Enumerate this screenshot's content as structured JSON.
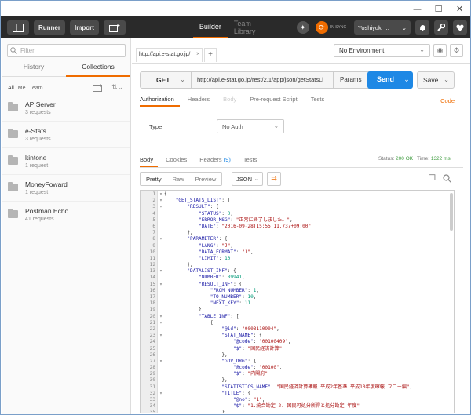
{
  "window": {
    "minimize": "—",
    "maximize": "☐",
    "close": "✕"
  },
  "toolbar": {
    "runner": "Runner",
    "import": "Import",
    "builder": "Builder",
    "team_library": "Team Library",
    "sync": "IN SYNC",
    "user": "Yoshiyuki ..."
  },
  "sidebar": {
    "filter_placeholder": "Filter",
    "tabs": [
      "History",
      "Collections"
    ],
    "sub": [
      "All",
      "Me",
      "Team"
    ],
    "collections": [
      {
        "name": "APIServer",
        "requests": "3 requests"
      },
      {
        "name": "e-Stats",
        "requests": "3 requests"
      },
      {
        "name": "kintone",
        "requests": "1 request"
      },
      {
        "name": "MoneyFoward",
        "requests": "1 request"
      },
      {
        "name": "Postman Echo",
        "requests": "41 requests"
      }
    ]
  },
  "request": {
    "tab_label": "http://api.e-stat.go.jp/",
    "tab_close": "×",
    "add_tab": "+",
    "environment": "No Environment",
    "method": "GET",
    "url": "http://api.e-stat.go.jp/rest/2.1/app/json/getStatsList?appId=&lang=J&searchWord=",
    "params": "Params",
    "send": "Send",
    "save": "Save",
    "tabs": [
      "Authorization",
      "Headers",
      "Body",
      "Pre-request Script",
      "Tests"
    ],
    "code": "Code",
    "type_label": "Type",
    "type_value": "No Auth"
  },
  "response": {
    "tabs": [
      "Body",
      "Cookies",
      "Headers",
      "Tests"
    ],
    "headers_count": "(9)",
    "status_label": "Status:",
    "status_value": "200 OK",
    "time_label": "Time:",
    "time_value": "1322 ms",
    "views": [
      "Pretty",
      "Raw",
      "Preview"
    ],
    "format": "JSON",
    "lines": [
      {
        "fold": "▾",
        "text": "{"
      },
      {
        "fold": "▾",
        "text": "    \"GET_STATS_LIST\": {"
      },
      {
        "fold": "▾",
        "text": "        \"RESULT\": {"
      },
      {
        "fold": "",
        "text": "            \"STATUS\": 0,"
      },
      {
        "fold": "",
        "text": "            \"ERROR_MSG\": \"正常に終了しました。\","
      },
      {
        "fold": "",
        "text": "            \"DATE\": \"2016-09-28T15:55:11.737+09:00\""
      },
      {
        "fold": "",
        "text": "        },"
      },
      {
        "fold": "▾",
        "text": "        \"PARAMETER\": {"
      },
      {
        "fold": "",
        "text": "            \"LANG\": \"J\","
      },
      {
        "fold": "",
        "text": "            \"DATA_FORMAT\": \"J\","
      },
      {
        "fold": "",
        "text": "            \"LIMIT\": 10"
      },
      {
        "fold": "",
        "text": "        },"
      },
      {
        "fold": "▾",
        "text": "        \"DATALIST_INF\": {"
      },
      {
        "fold": "",
        "text": "            \"NUMBER\": 89941,"
      },
      {
        "fold": "▾",
        "text": "            \"RESULT_INF\": {"
      },
      {
        "fold": "",
        "text": "                \"FROM_NUMBER\": 1,"
      },
      {
        "fold": "",
        "text": "                \"TO_NUMBER\": 10,"
      },
      {
        "fold": "",
        "text": "                \"NEXT_KEY\": 11"
      },
      {
        "fold": "",
        "text": "            },"
      },
      {
        "fold": "▾",
        "text": "            \"TABLE_INF\": ["
      },
      {
        "fold": "▾",
        "text": "                {"
      },
      {
        "fold": "",
        "text": "                    \"@id\": \"0003110904\","
      },
      {
        "fold": "▾",
        "text": "                    \"STAT_NAME\": {"
      },
      {
        "fold": "",
        "text": "                        \"@code\": \"00100409\","
      },
      {
        "fold": "",
        "text": "                        \"$\": \"国民経済計算\""
      },
      {
        "fold": "",
        "text": "                    },"
      },
      {
        "fold": "▾",
        "text": "                    \"GOV_ORG\": {"
      },
      {
        "fold": "",
        "text": "                        \"@code\": \"00100\","
      },
      {
        "fold": "",
        "text": "                        \"$\": \"内閣府\""
      },
      {
        "fold": "",
        "text": "                    },"
      },
      {
        "fold": "",
        "text": "                    \"STATISTICS_NAME\": \"国民経済計算確報 平成2年基準 平成10年度確報 フロー編\","
      },
      {
        "fold": "▾",
        "text": "                    \"TITLE\": {"
      },
      {
        "fold": "",
        "text": "                        \"@no\": \"1\","
      },
      {
        "fold": "",
        "text": "                        \"$\": \"1.統合勘定 2. 国民可処分所得と処分勘定 年度\""
      },
      {
        "fold": "",
        "text": "                    },"
      }
    ]
  }
}
